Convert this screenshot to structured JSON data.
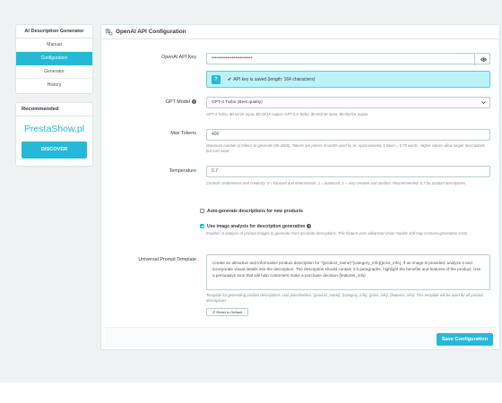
{
  "sidebar": {
    "title": "AI Description Generator",
    "items": [
      {
        "label": "Manual"
      },
      {
        "label": "Configuration"
      },
      {
        "label": "Generator"
      },
      {
        "label": "History"
      }
    ],
    "active_index": 1
  },
  "recommended": {
    "title": "Recommended",
    "brand": "PrestaShow.pl",
    "button": "DISCOVER"
  },
  "panel": {
    "title": "OpenAI API Configuration",
    "api_key": {
      "label": "OpenAI API Key",
      "value": "••••••••••••••••••••••••••",
      "saved_message": "API key is saved (length: 164 characters)"
    },
    "model": {
      "label": "GPT Model",
      "selected": "GPT-4 Turbo (Best quality)",
      "help": "GPT-4 Turbo: $0.01/1K input, $0.03/1K output. GPT-3.5 Turbo: $0.001/1K input, $0.002/1K output."
    },
    "max_tokens": {
      "label": "Max Tokens",
      "value": "400",
      "help": "Maximum number of tokens to generate (50-4000). Tokens are pieces of words used by AI. Approximately 1 token = 0.75 words. Higher values allow longer descriptions but cost more."
    },
    "temperature": {
      "label": "Temperature",
      "value": "0.7",
      "help": "Controls randomness and creativity: 0 = focused and deterministic, 1 = balanced, 2 = very creative and random. Recommended: 0.7 for product descriptions."
    },
    "auto_generate": {
      "label": "Auto-generate descriptions for new products",
      "checked": false
    },
    "image_analysis": {
      "label": "Use image analysis for description generation",
      "checked": true,
      "help": "Enables AI analysis of product images to generate more accurate descriptions. This feature uses advanced vision models and may increase generation costs."
    },
    "prompt": {
      "label": "Universal Prompt Template",
      "value": "Create an attractive and informative product description for \"{product_name}\"{category_info}{price_info}. If an image is provided, analyze it and incorporate visual details into the description. The description should contain 2-3 paragraphs, highlight the benefits and features of the product. Use a persuasive tone that will help customers make a purchase decision.{features_info}",
      "help": "Template for generating product descriptions. Use placeholders: {product_name}, {category_info}, {price_info}, {features_info}. This template will be used for all product descriptions.",
      "reset_label": "Reset to Default"
    },
    "save_label": "Save Configuration"
  },
  "colors": {
    "accent": "#25b9d7",
    "alert_bg": "#bcf2f8"
  }
}
